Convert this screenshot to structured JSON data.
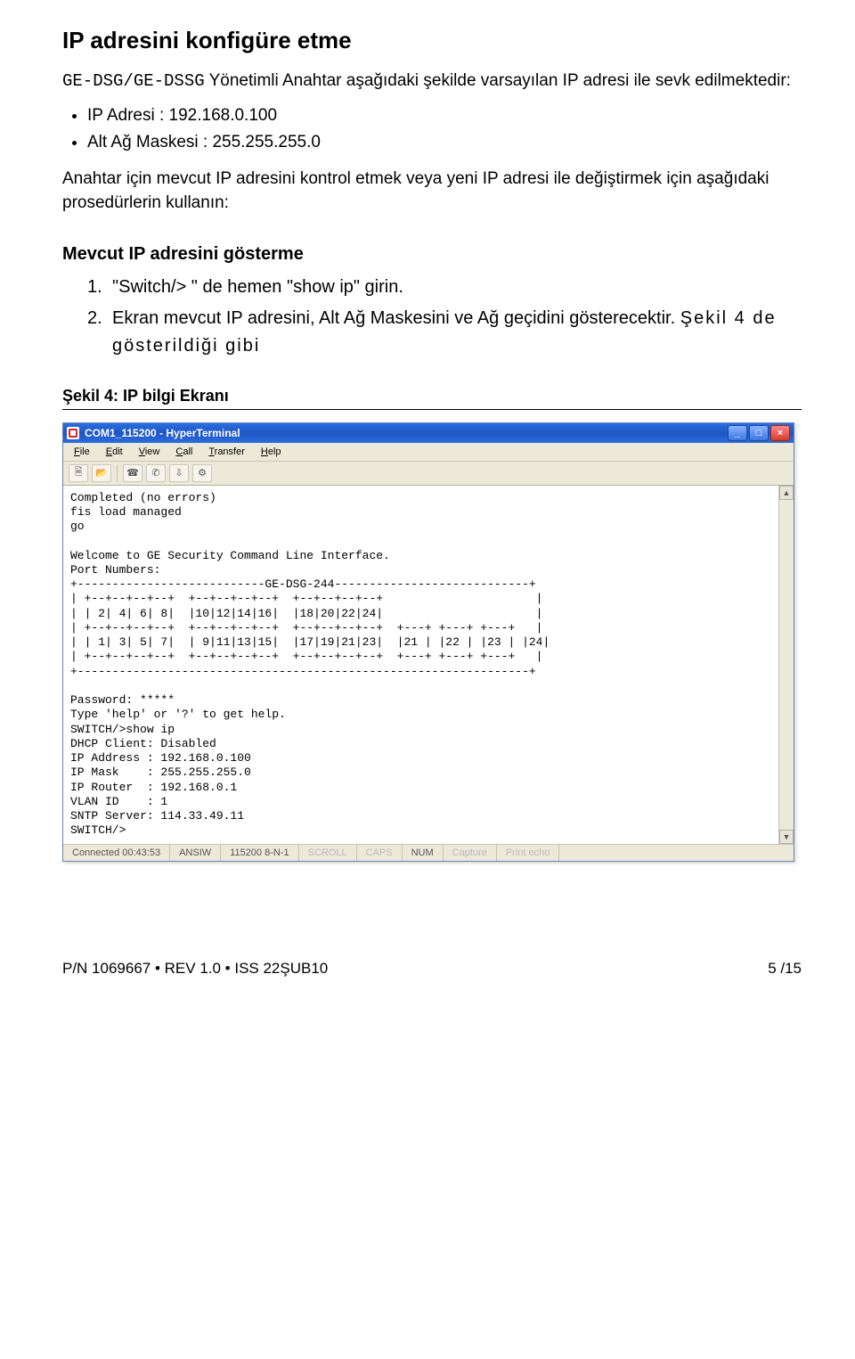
{
  "doc": {
    "section_title": "IP adresini konfigüre etme",
    "intro_prefix": "GE-DSG/GE-DSSG",
    "intro_rest": " Yönetimli Anahtar aşağıdaki şekilde varsayılan IP adresi ile sevk edilmektedir:",
    "bullets": [
      "IP Adresi : 192.168.0.100",
      "Alt Ağ Maskesi : 255.255.255.0"
    ],
    "after_bullets": "Anahtar için mevcut IP adresini kontrol etmek veya yeni IP adresi ile değiştirmek için aşağıdaki prosedürlerin kullanın:",
    "subheading": "Mevcut IP adresini gösterme",
    "steps": [
      "\"Switch/> \" de hemen \"show ip\" girin.",
      "Ekran mevcut IP adresini, Alt Ağ Maskesini ve Ağ geçidini gösterecektir."
    ],
    "step2_tail": "Şekil 4 de gösterildiği gibi",
    "figure_caption": "Şekil 4: IP bilgi Ekranı"
  },
  "window": {
    "title": "COM1_115200 - HyperTerminal",
    "menu": [
      "File",
      "Edit",
      "View",
      "Call",
      "Transfer",
      "Help"
    ]
  },
  "terminal": {
    "lines": "Completed (no errors)\nfis load managed\ngo\n\nWelcome to GE Security Command Line Interface.\nPort Numbers:\n+---------------------------GE-DSG-244----------------------------+\n| +--+--+--+--+  +--+--+--+--+  +--+--+--+--+                      |\n| | 2| 4| 6| 8|  |10|12|14|16|  |18|20|22|24|                      |\n| +--+--+--+--+  +--+--+--+--+  +--+--+--+--+  +---+ +---+ +---+   |\n| | 1| 3| 5| 7|  | 9|11|13|15|  |17|19|21|23|  |21 | |22 | |23 | |24|\n| +--+--+--+--+  +--+--+--+--+  +--+--+--+--+  +---+ +---+ +---+   |\n+-----------------------------------------------------------------+\n\nPassword: *****\nType 'help' or '?' to get help.\nSWITCH/>show ip\nDHCP Client: Disabled\nIP Address : 192.168.0.100\nIP Mask    : 255.255.255.0\nIP Router  : 192.168.0.1\nVLAN ID    : 1\nSNTP Server: 114.33.49.11\nSWITCH/>"
  },
  "statusbar": {
    "connected": "Connected 00:43:53",
    "emulation": "ANSIW",
    "port": "115200 8-N-1",
    "scroll": "SCROLL",
    "caps": "CAPS",
    "num": "NUM",
    "capture": "Capture",
    "printecho": "Print echo"
  },
  "footer": {
    "left": "P/N 1069667 • REV 1.0 • ISS 22ŞUB10",
    "right": "5 /15"
  }
}
